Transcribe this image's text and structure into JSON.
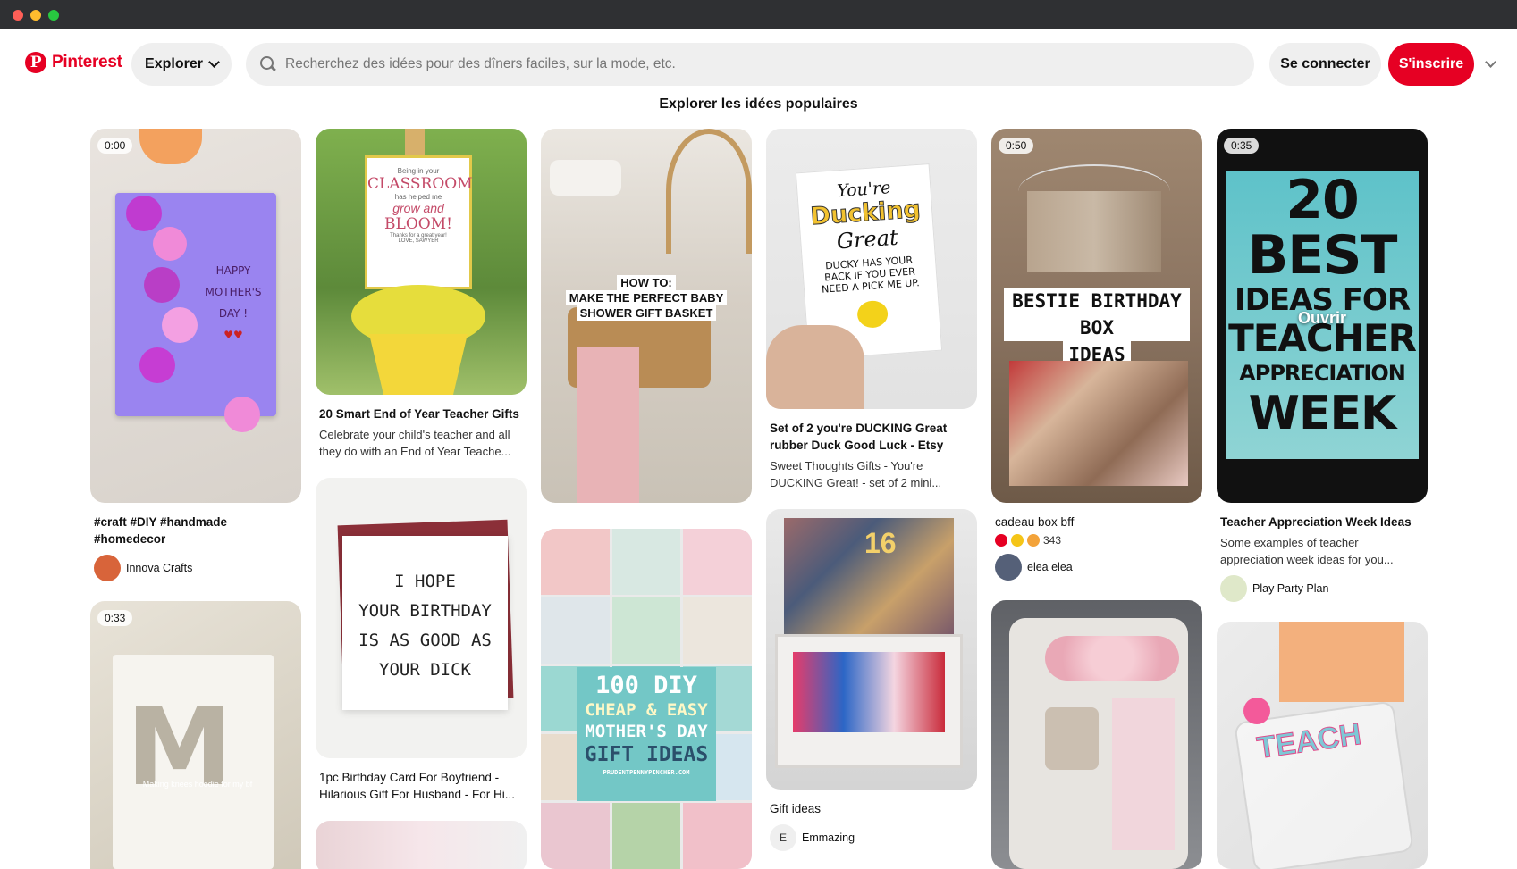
{
  "header": {
    "brand": "Pinterest",
    "logo_letter": "P",
    "explore_label": "Explorer",
    "search_placeholder": "Recherchez des idées pour des dîners faciles, sur la mode, etc.",
    "login_label": "Se connecter",
    "signup_label": "S'inscrire",
    "brand_color": "#e60023"
  },
  "section_title": "Explorer les idées populaires",
  "pins": {
    "col1": [
      {
        "badge": "0:00",
        "img_text_1": "HAPPY",
        "img_text_2": "MOTHER'S",
        "img_text_3": "DAY !",
        "title": "#craft #DIY #handmade #homedecor",
        "author": "Innova Crafts"
      },
      {
        "badge": "0:33",
        "img_text": "Making knees hoodie for my bf"
      }
    ],
    "col2": [
      {
        "img_text_1": "Being in your",
        "img_text_2": "CLASSROOM",
        "img_text_3": "has helped me",
        "img_text_4": "grow and",
        "img_text_5": "BLOOM!",
        "img_text_6": "Thanks for a great year!",
        "img_text_7": "LOVE, SAWYER",
        "title": "20 Smart End of Year Teacher Gifts",
        "desc": "Celebrate your child's teacher and all they do with an End of Year Teache..."
      },
      {
        "img_text_1": "I HOPE",
        "img_text_2": "YOUR BIRTHDAY",
        "img_text_3": "IS AS GOOD AS",
        "img_text_4": "YOUR DICK",
        "title": "1pc Birthday Card For Boyfriend - Hilarious Gift For Husband - For Hi..."
      },
      {}
    ],
    "col3": [
      {
        "img_text_1": "HOW TO:",
        "img_text_2": "MAKE THE PERFECT BABY",
        "img_text_3": "SHOWER GIFT BASKET"
      },
      {
        "img_text_1": "100 DIY",
        "img_text_2": "CHEAP & EASY",
        "img_text_3": "MOTHER'S DAY",
        "img_text_4": "GIFT IDEAS",
        "img_text_5": "PRUDENTPENNYPINCHER.COM"
      }
    ],
    "col4": [
      {
        "img_text_1": "You're",
        "img_text_2": "Ducking",
        "img_text_3": "Great",
        "img_text_4": "DUCKY HAS YOUR",
        "img_text_5": "BACK IF YOU EVER",
        "img_text_6": "NEED A PICK ME UP.",
        "title": "Set of 2 you're DUCKING Great rubber Duck Good Luck - Etsy",
        "desc": "Sweet Thoughts Gifts - You're DUCKING Great! - set of 2 mini..."
      },
      {
        "img_text": "16",
        "title": "Gift ideas",
        "author": "Emmazing",
        "avatar_letter": "E"
      }
    ],
    "col5": [
      {
        "badge": "0:50",
        "img_text_1": "BESTIE BIRTHDAY BOX",
        "img_text_2": "IDEAS",
        "title": "cadeau box bff",
        "reaction_count": "343",
        "author": "elea elea"
      },
      {}
    ],
    "col6": [
      {
        "badge": "0:35",
        "img_text_1": "20",
        "img_text_2": "BEST",
        "img_text_3": "IDEAS FOR",
        "img_text_4": "TEACHER",
        "img_text_5": "APPRECIATION",
        "img_text_6": "WEEK",
        "open_label": "Ouvrir",
        "title": "Teacher Appreciation Week Ideas",
        "desc": "Some examples of teacher appreciation week ideas for you...",
        "author": "Play Party Plan"
      },
      {
        "img_text": "TEACH"
      }
    ]
  }
}
